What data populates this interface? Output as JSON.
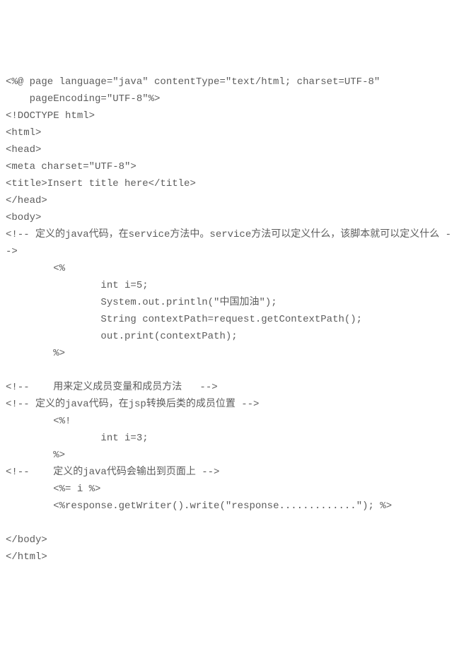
{
  "code": {
    "lines": [
      "<%@ page language=\"java\" contentType=\"text/html; charset=UTF-8\"",
      "    pageEncoding=\"UTF-8\"%>",
      "<!DOCTYPE html>",
      "<html>",
      "<head>",
      "<meta charset=\"UTF-8\">",
      "<title>Insert title here</title>",
      "</head>",
      "<body>",
      "<!-- 定义的java代码，在service方法中。service方法可以定义什么，该脚本就可以定义什么 -->",
      "        <%",
      "                int i=5;",
      "                System.out.println(\"中国加油\");",
      "                String contextPath=request.getContextPath();",
      "                out.print(contextPath);",
      "        %>",
      "        ",
      "<!--    用来定义成员变量和成员方法   -->",
      "<!-- 定义的java代码，在jsp转换后类的成员位置 -->",
      "        <%!",
      "                int i=3;",
      "        %>",
      "<!--    定义的java代码会输出到页面上 -->",
      "        <%= i %>",
      "        <%response.getWriter().write(\"response.............\"); %>",
      "",
      "</body>",
      "</html>"
    ]
  }
}
